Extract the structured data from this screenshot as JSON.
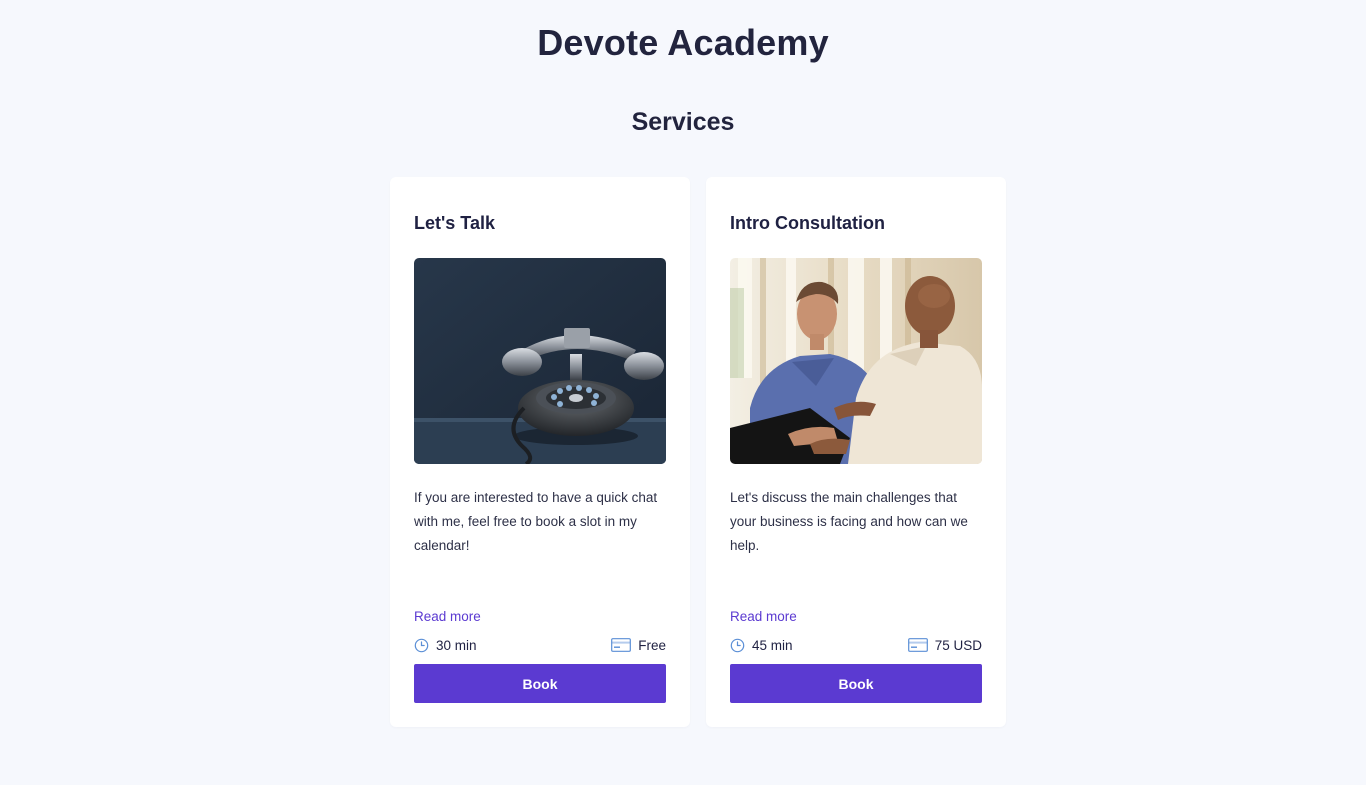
{
  "header": {
    "title": "Devote Academy",
    "section_title": "Services"
  },
  "colors": {
    "background": "#f6f8fd",
    "card": "#ffffff",
    "accent": "#5b3ad1",
    "heading": "#22243e",
    "text": "#2d3047"
  },
  "services": [
    {
      "title": "Let's Talk",
      "image": "vintage-rotary-telephone-photo",
      "description": "If you are interested to have a quick chat with me, feel free to book a slot in my calendar!",
      "read_more": "Read more",
      "duration": "30 min",
      "duration_icon": "clock-icon",
      "price": "Free",
      "price_icon": "card-icon",
      "book_label": "Book"
    },
    {
      "title": "Intro Consultation",
      "image": "two-men-meeting-photo",
      "description": "Let's discuss the main challenges that your business is facing and how can we help.",
      "read_more": "Read more",
      "duration": "45 min",
      "duration_icon": "clock-icon",
      "price": "75 USD",
      "price_icon": "card-icon",
      "book_label": "Book"
    }
  ]
}
